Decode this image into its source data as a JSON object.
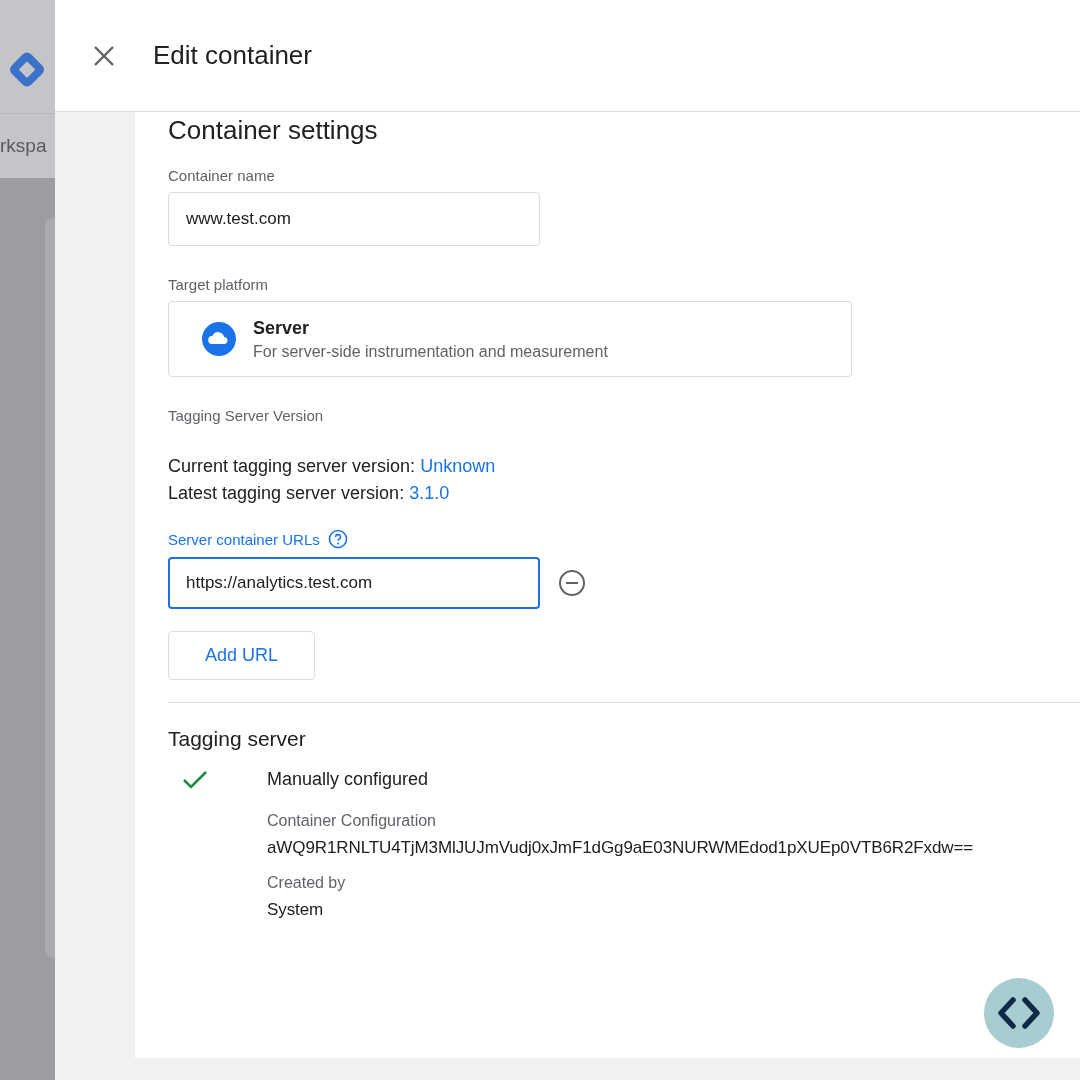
{
  "background_app": {
    "sidebar_label": "rkspa"
  },
  "panel": {
    "title": "Edit container"
  },
  "section_title": "Container settings",
  "container_name": {
    "label": "Container name",
    "value": "www.test.com"
  },
  "target_platform": {
    "label": "Target platform",
    "name": "Server",
    "description": "For server-side instrumentation and measurement"
  },
  "tagging_server_version": {
    "label": "Tagging Server Version",
    "lines": [
      {
        "label": "Current tagging server version:",
        "value": "Unknown"
      },
      {
        "label": "Latest tagging server version:",
        "value": "3.1.0"
      }
    ]
  },
  "server_urls": {
    "label": "Server container URLs",
    "fields": [
      {
        "value": "https://analytics.test.com",
        "focused": true
      }
    ],
    "add_button": "Add URL"
  },
  "tagging_server": {
    "title": "Tagging server",
    "status": "Manually configured",
    "checked": true,
    "details": [
      {
        "label": "Container Configuration",
        "value": "aWQ9R1RNLTU4TjM3MlJUJmVudj0xJmF1dGg9aE03NURWMEdod1pXUEp0VTB6R2Fxdw=="
      },
      {
        "label": "Created by",
        "value": "System"
      }
    ]
  }
}
